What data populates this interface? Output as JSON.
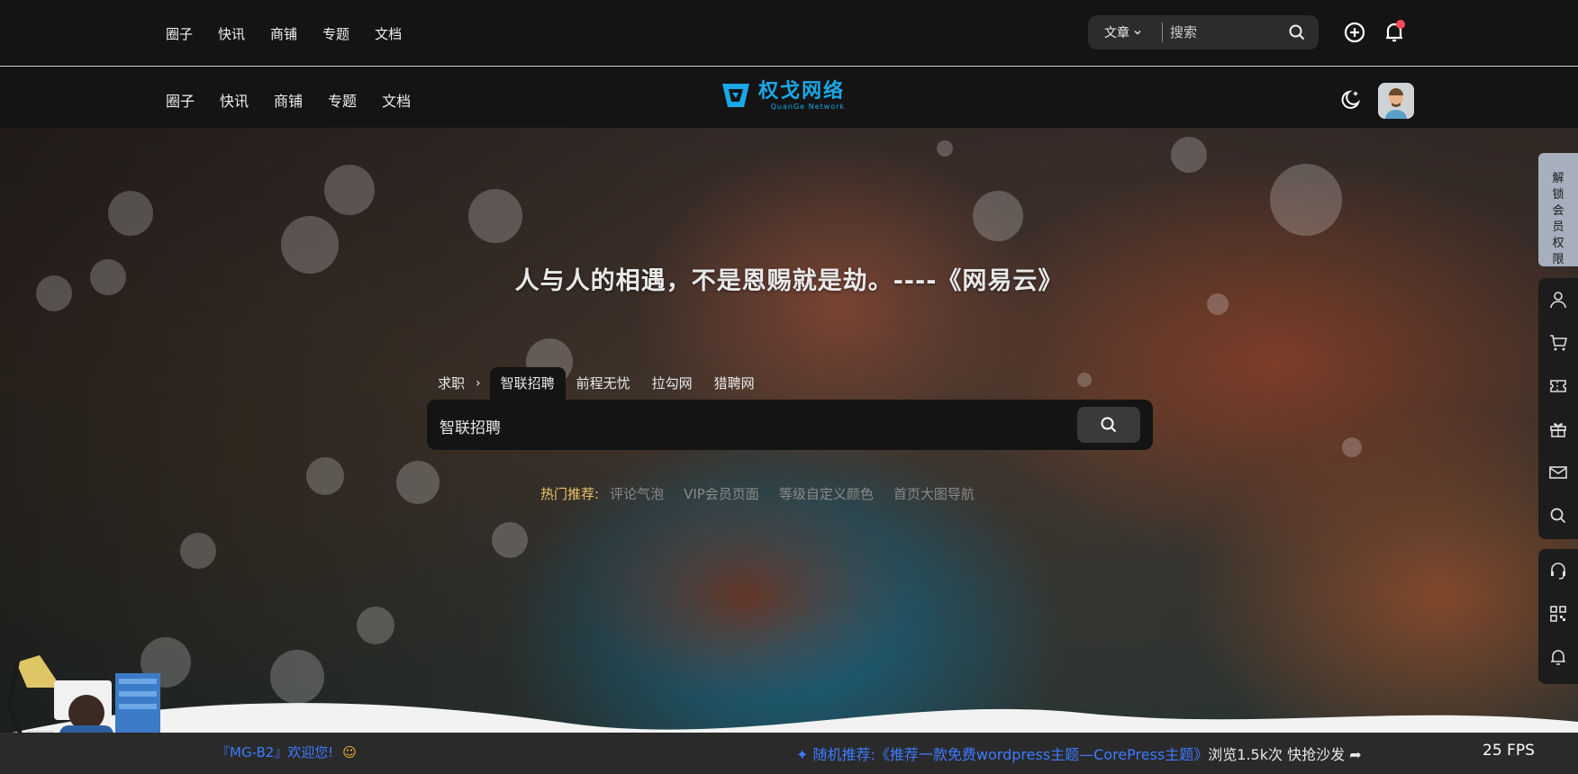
{
  "topbar": {
    "nav": [
      "圈子",
      "快讯",
      "商铺",
      "专题",
      "文档"
    ],
    "search_category": "文章",
    "search_placeholder": "搜索",
    "icons": [
      "chevron-down-icon",
      "search-icon",
      "plus-circle-icon",
      "bell-icon"
    ]
  },
  "header": {
    "nav": [
      "圈子",
      "快讯",
      "商铺",
      "专题",
      "文档"
    ],
    "logo_cn": "权戈网络",
    "logo_en": "QuanGe Network",
    "icons": [
      "moon-star-icon",
      "avatar"
    ]
  },
  "hero": {
    "quote": "人与人的相遇，不是恩赐就是劫。----《网易云》",
    "search_lead": "求职",
    "search_tabs": [
      "智联招聘",
      "前程无忧",
      "拉勾网",
      "猎聘网"
    ],
    "active_tab": "智联招聘",
    "search_value": "智联招聘",
    "hot_label": "热门推荐:",
    "hot_items": [
      "评论气泡",
      "VIP会员页面",
      "等级自定义颜色",
      "首页大图导航"
    ]
  },
  "footer": {
    "welcome": "『MG-B2』欢迎您!",
    "random_label": "随机推荐:",
    "random_title": "《推荐一款免费wordpress主题—CorePress主题》",
    "random_views": "浏览1.5k次",
    "random_action": "快抢沙发",
    "fps": "25 FPS"
  },
  "dock": {
    "unlock": "解锁会员权限",
    "icons": [
      "user-icon",
      "cart-icon",
      "ticket-icon",
      "gift-icon",
      "mail-icon",
      "search-icon",
      "headset-icon",
      "qrcode-icon",
      "bell-icon"
    ]
  },
  "colors": {
    "accent": "#3d7bff",
    "logo": "#1aa7e8",
    "hot_label": "#f0c36a",
    "notification": "#ff4a5a"
  }
}
